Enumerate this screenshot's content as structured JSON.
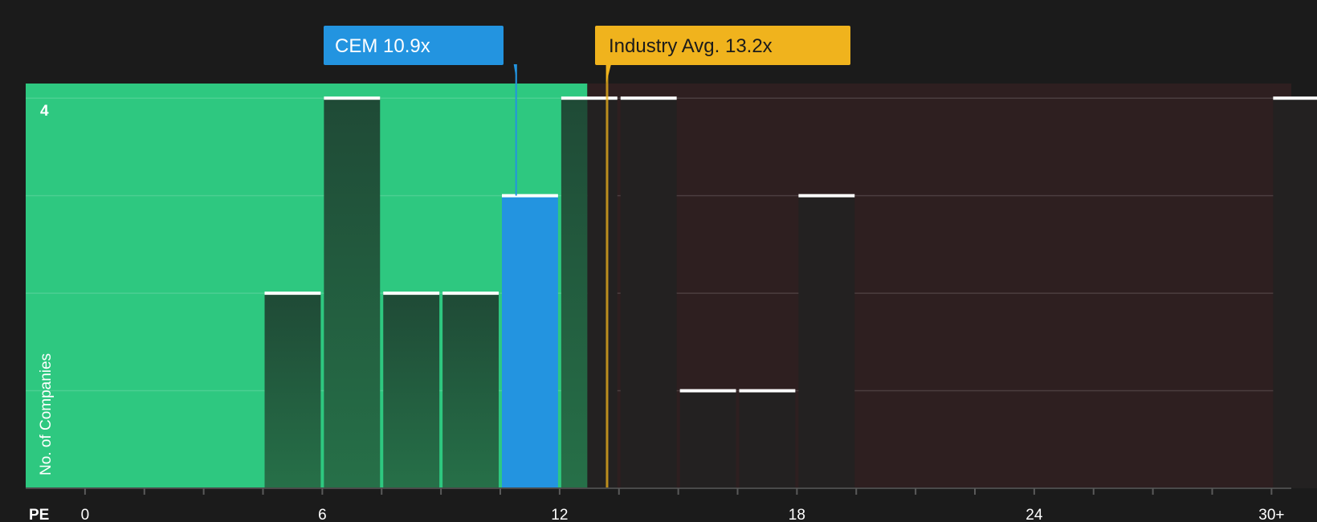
{
  "chart_data": {
    "type": "bar",
    "xlabel": "PE",
    "ylabel": "No. of Companies",
    "xlim": [
      -1.5,
      30.5
    ],
    "ylim": [
      0,
      4.15
    ],
    "x_ticks": [
      {
        "value": 0,
        "label": "0"
      },
      {
        "value": 6,
        "label": "6"
      },
      {
        "value": 12,
        "label": "12"
      },
      {
        "value": 18,
        "label": "18"
      },
      {
        "value": 24,
        "label": "24"
      },
      {
        "value": 30,
        "label": "30+"
      }
    ],
    "y_ticks": [
      {
        "value": 4,
        "label": "4"
      }
    ],
    "grid": true,
    "bins": [
      {
        "x0": 4.5,
        "x1": 6.0,
        "count": 2
      },
      {
        "x0": 6.0,
        "x1": 7.5,
        "count": 4
      },
      {
        "x0": 7.5,
        "x1": 9.0,
        "count": 2
      },
      {
        "x0": 9.0,
        "x1": 10.5,
        "count": 2
      },
      {
        "x0": 10.5,
        "x1": 12.0,
        "count": 3,
        "highlight": true
      },
      {
        "x0": 12.0,
        "x1": 13.5,
        "count": 4
      },
      {
        "x0": 13.5,
        "x1": 15.0,
        "count": 4
      },
      {
        "x0": 15.0,
        "x1": 16.5,
        "count": 1
      },
      {
        "x0": 16.5,
        "x1": 18.0,
        "count": 1
      },
      {
        "x0": 18.0,
        "x1": 19.5,
        "count": 3
      },
      {
        "x0": 30.0,
        "x1": 31.5,
        "count": 4
      }
    ],
    "company": {
      "value": 10.9,
      "label": "CEM 10.9x",
      "color": "#2394e0"
    },
    "industry": {
      "value": 13.2,
      "label": "Industry Avg. 13.2x",
      "color": "#f0b31d"
    },
    "fair_zone_end": 12.7,
    "colors": {
      "background": "#1b1b1b",
      "good_zone": "#2ec880",
      "bad_zone": "#2e1f20",
      "bar_good": "#23593e",
      "bar_bad": "#232121",
      "cap": "#ffffff"
    }
  }
}
